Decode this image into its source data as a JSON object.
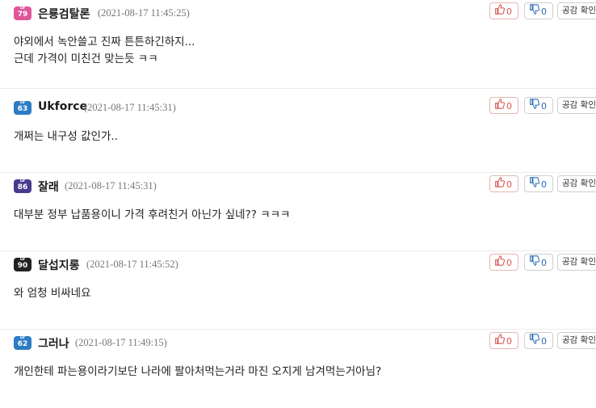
{
  "comments": [
    {
      "level": "79",
      "nick": "은룡검탈론",
      "date": "(2021-08-17 11:45:25)",
      "lines": [
        "야외에서 녹안쓸고 진짜 튼튼하긴하지...",
        "근데 가격이 미친건 맞는듯 ㅋㅋ"
      ],
      "likes": "0",
      "dislikes": "0",
      "share": "공감 확인",
      "badge_color": "#e0559a"
    },
    {
      "level": "63",
      "nick": "Ukforce",
      "date": "(2021-08-17 11:45:31)",
      "lines": [
        "개쩌는 내구성 값인가.."
      ],
      "likes": "0",
      "dislikes": "0",
      "share": "공감 확인",
      "badge_color": "#2d7bc4"
    },
    {
      "level": "86",
      "nick": "잘래",
      "date": "(2021-08-17 11:45:31)",
      "lines": [
        "대부분 정부 납품용이니 가격 후려친거 아닌가 싶네?? ㅋㅋㅋ"
      ],
      "likes": "0",
      "dislikes": "0",
      "share": "공감 확인",
      "badge_color": "#4a3a8f"
    },
    {
      "level": "90",
      "nick": "달섭지롱",
      "date": "(2021-08-17 11:45:52)",
      "lines": [
        "와 엄청 비싸네요"
      ],
      "likes": "0",
      "dislikes": "0",
      "share": "공감 확인",
      "badge_color": "#222222"
    },
    {
      "level": "62",
      "nick": "그러나",
      "date": "(2021-08-17 11:49:15)",
      "lines": [
        "개인한테 파는용이라기보단 나라에 팔아처먹는거라 마진 오지게 남겨먹는거아님?"
      ],
      "likes": "0",
      "dislikes": "0",
      "share": "공감 확인",
      "badge_color": "#2d7bc4"
    }
  ]
}
